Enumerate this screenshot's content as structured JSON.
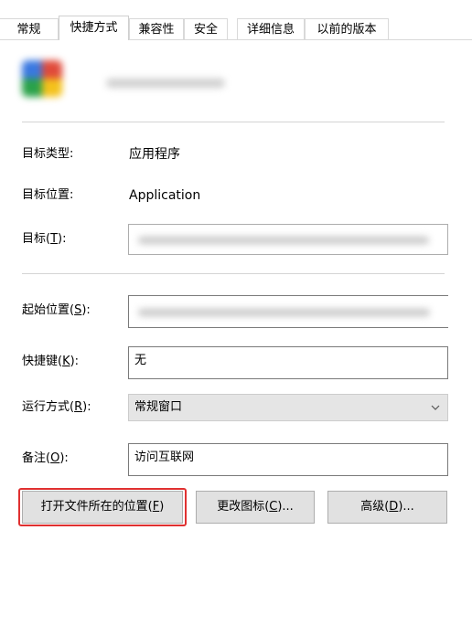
{
  "tabs": [
    {
      "label": "常规",
      "active": false
    },
    {
      "label": "快捷方式",
      "active": true
    },
    {
      "label": "兼容性",
      "active": false
    },
    {
      "label": "安全",
      "active": false
    },
    {
      "label": "详细信息",
      "active": false
    },
    {
      "label": "以前的版本",
      "active": false
    }
  ],
  "shortcut": {
    "target_type_label": "目标类型:",
    "target_type_value": "应用程序",
    "target_location_label": "目标位置:",
    "target_location_value": "Application",
    "target_label_prefix": "目标(",
    "target_label_key": "T",
    "target_label_suffix": "):",
    "start_in_label_prefix": "起始位置(",
    "start_in_label_key": "S",
    "start_in_label_suffix": "):",
    "hotkey_label_prefix": "快捷键(",
    "hotkey_label_key": "K",
    "hotkey_label_suffix": "):",
    "hotkey_value": "无",
    "run_label_prefix": "运行方式(",
    "run_label_key": "R",
    "run_label_suffix": "):",
    "run_value": "常规窗口",
    "comment_label_prefix": "备注(",
    "comment_label_key": "O",
    "comment_label_suffix": "):",
    "comment_value": "访问互联网"
  },
  "buttons": {
    "open_location_prefix": "打开文件所在的位置(",
    "open_location_key": "F",
    "open_location_suffix": ")",
    "change_icon_prefix": "更改图标(",
    "change_icon_key": "C",
    "change_icon_suffix": ")...",
    "advanced_prefix": "高级(",
    "advanced_key": "D",
    "advanced_suffix": ")..."
  },
  "colors": {
    "highlight": "#e03030",
    "border": "#adadad",
    "select_bg": "#e5e5e5"
  }
}
